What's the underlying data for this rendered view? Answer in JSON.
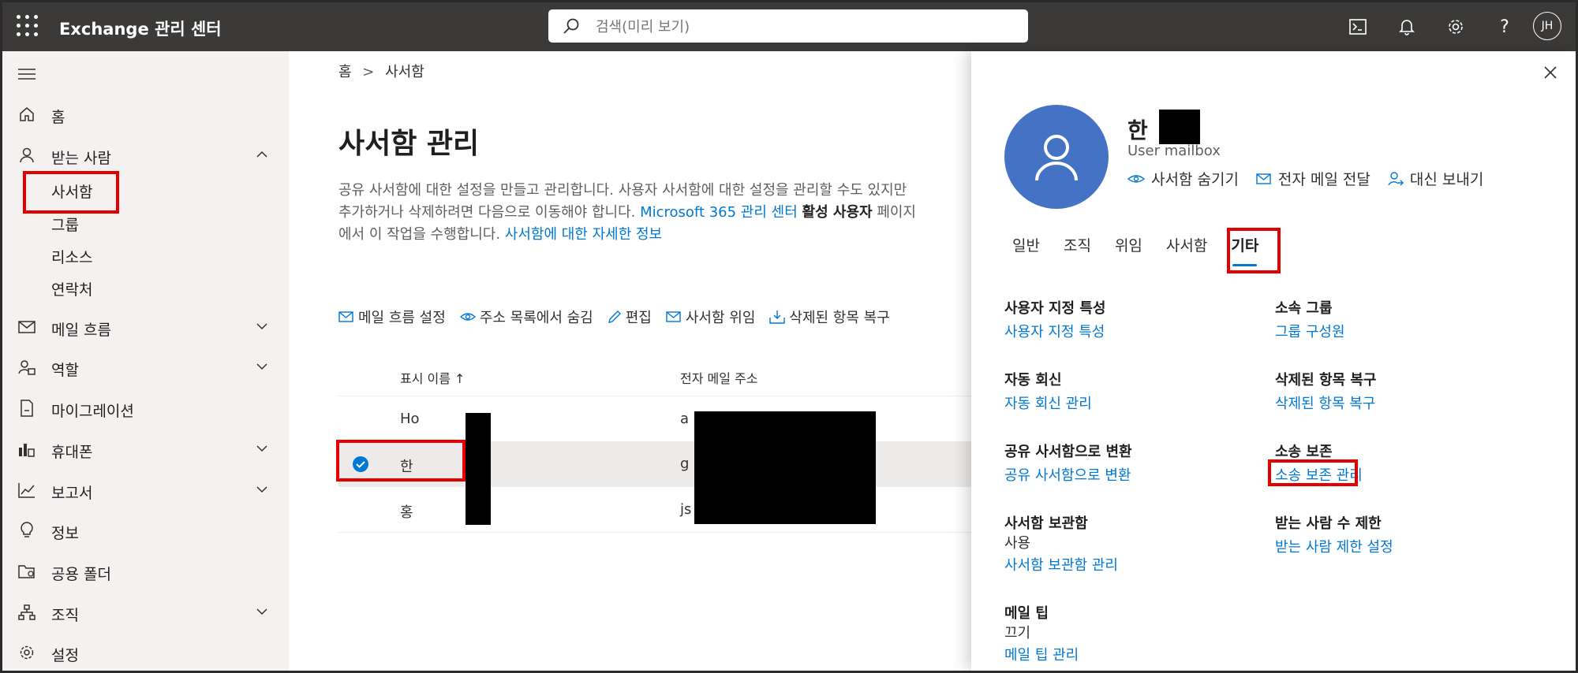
{
  "header": {
    "app_title": "Exchange 관리 센터",
    "search_placeholder": "검색(미리 보기)",
    "avatar_initials": "JH"
  },
  "sidebar": {
    "items": [
      {
        "label": "홈",
        "icon": "home-icon"
      },
      {
        "label": "받는 사람",
        "icon": "person-icon",
        "expanded": true
      },
      {
        "label": "메일 흐름",
        "icon": "mail-icon"
      },
      {
        "label": "역할",
        "icon": "roles-icon"
      },
      {
        "label": "마이그레이션",
        "icon": "migration-icon"
      },
      {
        "label": "휴대폰",
        "icon": "mobile-icon"
      },
      {
        "label": "보고서",
        "icon": "chart-icon"
      },
      {
        "label": "정보",
        "icon": "lightbulb-icon"
      },
      {
        "label": "공용 폴더",
        "icon": "folder-icon"
      },
      {
        "label": "조직",
        "icon": "org-icon"
      },
      {
        "label": "설정",
        "icon": "gear-icon"
      }
    ],
    "recipients_sub": [
      "사서함",
      "그룹",
      "리소스",
      "연락처"
    ]
  },
  "main": {
    "breadcrumb": {
      "home": "홈",
      "sep": ">",
      "current": "사서함"
    },
    "title": "사서함 관리",
    "desc": {
      "line1": "공유 사서함에 대한 설정을 만들고 관리합니다. 사용자 사서함에 대한 설정을 관리할 수도 있지만",
      "line2_a": "추가하거나 삭제하려면 다음으로 이동해야 합니다. ",
      "line2_link": "Microsoft 365 관리 센터",
      "line2_b": "활성 사용자",
      "line2_c": " 페이지",
      "line3_a": "에서 이 작업을 수행합니다. ",
      "line3_link": "사서함에 대한 자세한 정보"
    },
    "toolbar": [
      "메일 흐름 설정",
      "주소 목록에서 숨김",
      "편집",
      "사서함 위임",
      "삭제된 항목 복구"
    ],
    "table": {
      "col_name": "표시 이름 ↑",
      "col_email": "전자 메일 주소",
      "rows": [
        {
          "name": "Ho",
          "email": "a"
        },
        {
          "name": "한",
          "email": "g"
        },
        {
          "name": "홍",
          "email": "js"
        }
      ]
    }
  },
  "panel": {
    "name": "한",
    "type": "User mailbox",
    "actions": [
      "사서함 숨기기",
      "전자 메일 전달",
      "대신 보내기"
    ],
    "tabs": [
      "일반",
      "조직",
      "위임",
      "사서함",
      "기타"
    ],
    "sections": {
      "custom_attr": {
        "title": "사용자 지정 특성",
        "link": "사용자 지정 특성"
      },
      "member_of": {
        "title": "소속 그룹",
        "link": "그룹 구성원"
      },
      "auto_reply": {
        "title": "자동 회신",
        "link": "자동 회신 관리"
      },
      "deleted_items": {
        "title": "삭제된 항목 복구",
        "link": "삭제된 항목 복구"
      },
      "convert_shared": {
        "title": "공유 사서함으로 변환",
        "link": "공유 사서함으로 변환"
      },
      "litigation": {
        "title": "소송 보존",
        "link": "소송 보존 관리"
      },
      "archive": {
        "title": "사서함 보관함",
        "value": "사용",
        "link": "사서함 보관함 관리"
      },
      "recipient_limit": {
        "title": "받는 사람 수 제한",
        "link": "받는 사람 제한 설정"
      },
      "mailtips": {
        "title": "메일 팁",
        "value": "끄기",
        "link": "메일 팁 관리"
      }
    }
  },
  "colors": {
    "accent": "#0078d4",
    "header": "#3b3a39",
    "avatar": "#4472c4",
    "highlight": "#e30000"
  }
}
